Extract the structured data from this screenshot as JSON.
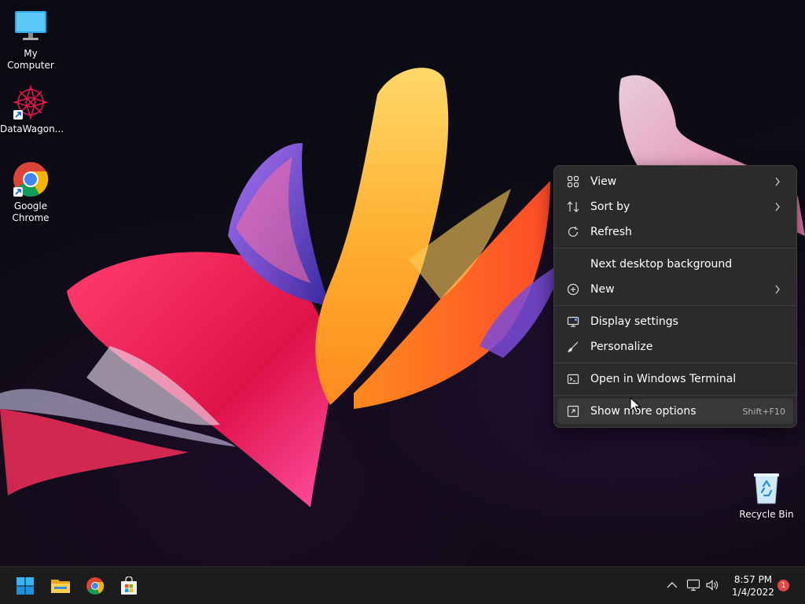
{
  "desktop": {
    "icons": [
      {
        "label": "My Computer",
        "icon": "monitor-icon"
      },
      {
        "label": "DataWagon...",
        "icon": "datawagon-logo-icon"
      },
      {
        "label": "Google\nChrome",
        "icon": "chrome-icon"
      },
      {
        "label": "Recycle Bin",
        "icon": "recycle-bin-icon"
      }
    ]
  },
  "context_menu": {
    "items": [
      {
        "label": "View",
        "icon": "grid-icon",
        "submenu": true
      },
      {
        "label": "Sort by",
        "icon": "sort-arrows-icon",
        "submenu": true
      },
      {
        "label": "Refresh",
        "icon": "refresh-icon"
      },
      {
        "label": "Next desktop background",
        "icon": ""
      },
      {
        "label": "New",
        "icon": "plus-circle-icon",
        "submenu": true
      },
      {
        "label": "Display settings",
        "icon": "display-icon"
      },
      {
        "label": "Personalize",
        "icon": "brush-icon"
      },
      {
        "label": "Open in Windows Terminal",
        "icon": "terminal-icon"
      },
      {
        "label": "Show more options",
        "icon": "expand-icon",
        "accelerator": "Shift+F10"
      }
    ]
  },
  "taskbar": {
    "apps": [
      {
        "name": "start",
        "icon": "windows-start-icon"
      },
      {
        "name": "file-explorer",
        "icon": "folder-icon"
      },
      {
        "name": "chrome",
        "icon": "chrome-icon"
      },
      {
        "name": "store",
        "icon": "store-icon"
      }
    ],
    "tray": {
      "clock_time": "8:57 PM",
      "clock_date": "1/4/2022",
      "notification_count": "1"
    }
  },
  "colors": {
    "menu_bg": "#2b2b2b",
    "taskbar_bg": "#1c1c1c",
    "accent": "#0078d4"
  }
}
